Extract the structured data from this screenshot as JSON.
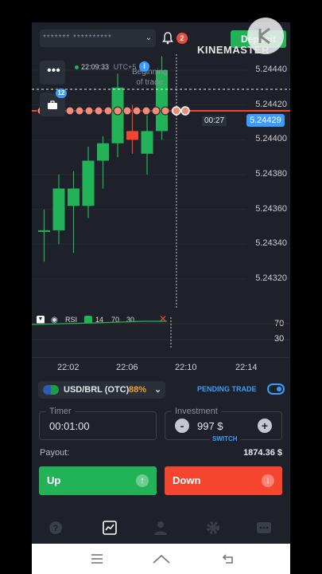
{
  "header": {
    "account_masked": "******* **********",
    "notification_count": "2",
    "deposit_label": "Deposit"
  },
  "watermark": {
    "text": "KINEMASTER"
  },
  "chart": {
    "clock": "22:09:33",
    "tz_fragment": "UTC+5",
    "trade_badge_count": "12",
    "tooltip_line1": "Beginning",
    "tooltip_line2": "of trade",
    "countdown": "00:27",
    "current_price": "5.24429",
    "price_labels": [
      "5.24440",
      "5.24420",
      "5.24400",
      "5.24380",
      "5.24360",
      "5.24340",
      "5.24320"
    ]
  },
  "chart_data": {
    "type": "candlestick",
    "y_ticks": [
      5.2444,
      5.2442,
      5.244,
      5.2438,
      5.2436,
      5.2434,
      5.2432
    ],
    "x_ticks": [
      "22:02",
      "22:06",
      "22:10",
      "22:14"
    ],
    "current_price": 5.24429,
    "candles": [
      {
        "o": 5.24348,
        "c": 5.24348,
        "h": 5.2436,
        "l": 5.2433,
        "dir": "up"
      },
      {
        "o": 5.24348,
        "c": 5.24372,
        "h": 5.2438,
        "l": 5.2434,
        "dir": "up"
      },
      {
        "o": 5.24372,
        "c": 5.24362,
        "h": 5.24382,
        "l": 5.24335,
        "dir": "up"
      },
      {
        "o": 5.24362,
        "c": 5.24388,
        "h": 5.24396,
        "l": 5.24355,
        "dir": "up"
      },
      {
        "o": 5.24388,
        "c": 5.24398,
        "h": 5.24402,
        "l": 5.24372,
        "dir": "up"
      },
      {
        "o": 5.24398,
        "c": 5.2443,
        "h": 5.24438,
        "l": 5.2439,
        "dir": "up"
      },
      {
        "o": 5.24405,
        "c": 5.244,
        "h": 5.2442,
        "l": 5.24392,
        "dir": "down"
      },
      {
        "o": 5.24392,
        "c": 5.24405,
        "h": 5.24415,
        "l": 5.2438,
        "dir": "up"
      },
      {
        "o": 5.24405,
        "c": 5.2444,
        "h": 5.24448,
        "l": 5.244,
        "dir": "up"
      }
    ],
    "rsi": {
      "label": "RSI",
      "period": "14",
      "upper": "70",
      "lower": "30"
    }
  },
  "asset": {
    "name": "USD/BRL (OTC)",
    "payout_percent": "88%",
    "pending_trade_label": "PENDING TRADE"
  },
  "timer": {
    "label": "Timer",
    "value": "00:01:00"
  },
  "investment": {
    "label": "Investment",
    "value": "997 $",
    "switch_label": "SWITCH"
  },
  "payout": {
    "label": "Payout:",
    "value": "1874.36 $"
  },
  "buttons": {
    "up_label": "Up",
    "down_label": "Down"
  },
  "colors": {
    "up": "#22b358",
    "down": "#f5452f",
    "accent": "#3b9cff",
    "bg": "#1e2129"
  }
}
